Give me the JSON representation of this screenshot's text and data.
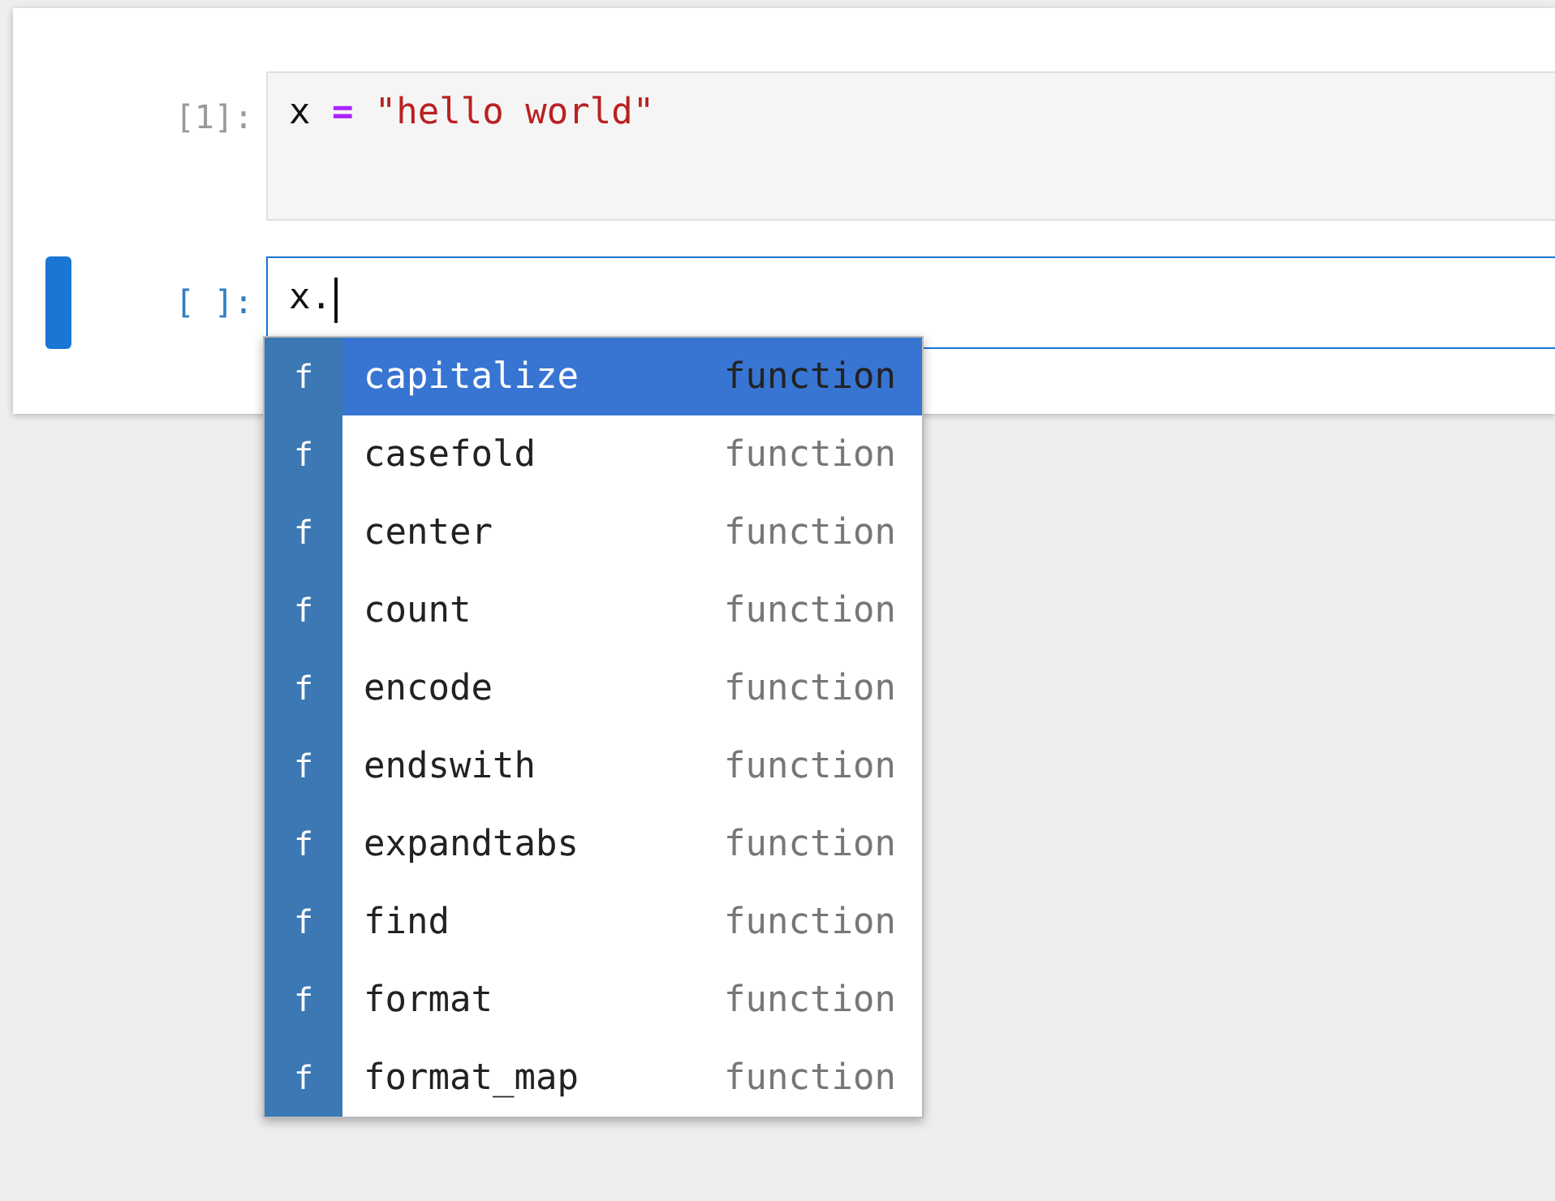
{
  "cells": [
    {
      "prompt": "[1]:",
      "active": false,
      "tokens": [
        {
          "kind": "name",
          "text": "x"
        },
        {
          "kind": "operator",
          "text": "="
        },
        {
          "kind": "string",
          "text": "\"hello world\""
        }
      ]
    },
    {
      "prompt": "[ ]:",
      "active": true,
      "tokens": [
        {
          "kind": "name",
          "text": "x."
        }
      ]
    }
  ],
  "completer": {
    "items": [
      {
        "icon": "f",
        "label": "capitalize",
        "type": "function",
        "selected": true
      },
      {
        "icon": "f",
        "label": "casefold",
        "type": "function",
        "selected": false
      },
      {
        "icon": "f",
        "label": "center",
        "type": "function",
        "selected": false
      },
      {
        "icon": "f",
        "label": "count",
        "type": "function",
        "selected": false
      },
      {
        "icon": "f",
        "label": "encode",
        "type": "function",
        "selected": false
      },
      {
        "icon": "f",
        "label": "endswith",
        "type": "function",
        "selected": false
      },
      {
        "icon": "f",
        "label": "expandtabs",
        "type": "function",
        "selected": false
      },
      {
        "icon": "f",
        "label": "find",
        "type": "function",
        "selected": false
      },
      {
        "icon": "f",
        "label": "format",
        "type": "function",
        "selected": false
      },
      {
        "icon": "f",
        "label": "format_map",
        "type": "function",
        "selected": false
      }
    ]
  }
}
